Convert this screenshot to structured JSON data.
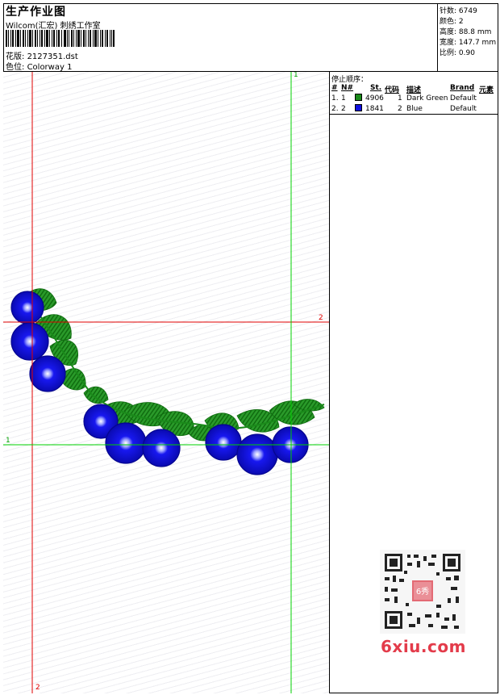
{
  "header": {
    "title": "生产作业图",
    "company": "Wilcom(汇宏) 刺绣工作室",
    "design_label": "花版",
    "design_value": "2127351.dst",
    "colorway_label": "色位",
    "colorway_value": "Colorway 1"
  },
  "stats": {
    "stitches_label": "针数",
    "stitches_value": "6749",
    "colors_label": "颜色",
    "colors_value": "2",
    "height_label": "高度",
    "height_value": "88.8 mm",
    "width_label": "宽度",
    "width_value": "147.7 mm",
    "scale_label": "比例",
    "scale_value": "0.90"
  },
  "legend": {
    "title": "停止顺序：",
    "headers": [
      "#",
      "N#",
      "St.",
      "代码",
      "描述",
      "Brand",
      "元素"
    ],
    "rows": [
      {
        "index": "1.",
        "needle": "1",
        "stitches": "4906",
        "code": "1",
        "description": "Dark Green",
        "brand": "Default",
        "color": "#1a8a1a"
      },
      {
        "index": "2.",
        "needle": "2",
        "stitches": "1841",
        "code": "2",
        "description": "Blue",
        "brand": "Default",
        "color": "#1010e0"
      }
    ]
  },
  "guides": {
    "top_label": "1",
    "right_label": "2",
    "left_label": "1",
    "bottom_label": "2",
    "red": "#e00000",
    "green": "#00d000"
  },
  "watermark": {
    "text": "6xiu.com",
    "qr_center_text": "6秀"
  }
}
